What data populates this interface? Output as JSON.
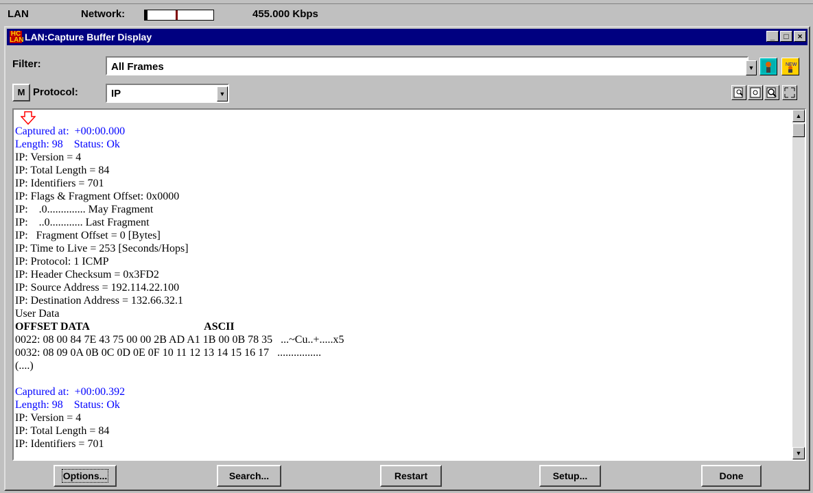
{
  "statusbar": {
    "label": "LAN",
    "network_label": "Network:",
    "network_utilization": 0.42,
    "network_peak": 0.45,
    "rate": "455.000 Kbps"
  },
  "window": {
    "title": "LAN:Capture Buffer Display",
    "minimize_glyph": "_",
    "maximize_glyph": "□",
    "close_glyph": "×"
  },
  "filter": {
    "label": "Filter:",
    "value": "All Frames"
  },
  "protocol": {
    "m_label": "M",
    "label": "Protocol:",
    "value": "IP"
  },
  "display": {
    "lines": [
      {
        "text": "Captured at:  +00:00.000",
        "style": "blue"
      },
      {
        "text": "Length: 98    Status: Ok",
        "style": "blue"
      },
      {
        "text": "IP: Version = 4",
        "style": ""
      },
      {
        "text": "IP: Total Length = 84",
        "style": ""
      },
      {
        "text": "IP: Identifiers = 701",
        "style": ""
      },
      {
        "text": "IP: Flags & Fragment Offset: 0x0000",
        "style": ""
      },
      {
        "text": "IP:    .0.............. May Fragment",
        "style": ""
      },
      {
        "text": "IP:    ..0............ Last Fragment",
        "style": ""
      },
      {
        "text": "IP:   Fragment Offset = 0 [Bytes]",
        "style": ""
      },
      {
        "text": "IP: Time to Live = 253 [Seconds/Hops]",
        "style": ""
      },
      {
        "text": "IP: Protocol: 1 ICMP",
        "style": ""
      },
      {
        "text": "IP: Header Checksum = 0x3FD2",
        "style": ""
      },
      {
        "text": "IP: Source Address = 192.114.22.100",
        "style": ""
      },
      {
        "text": "IP: Destination Address = 132.66.32.1",
        "style": ""
      },
      {
        "text": "User Data",
        "style": ""
      },
      {
        "text": "OFFSET DATA                                          ASCII",
        "style": "bold"
      },
      {
        "text": "0022: 08 00 84 7E 43 75 00 00 2B AD A1 1B 00 0B 78 35   ...~Cu..+.....x5",
        "style": ""
      },
      {
        "text": "0032: 08 09 0A 0B 0C 0D 0E 0F 10 11 12 13 14 15 16 17   ................",
        "style": ""
      },
      {
        "text": "(....)",
        "style": ""
      },
      {
        "text": "",
        "style": ""
      },
      {
        "text": "Captured at:  +00:00.392",
        "style": "blue"
      },
      {
        "text": "Length: 98    Status: Ok",
        "style": "blue"
      },
      {
        "text": "IP: Version = 4",
        "style": ""
      },
      {
        "text": "IP: Total Length = 84",
        "style": ""
      },
      {
        "text": "IP: Identifiers = 701",
        "style": ""
      }
    ]
  },
  "buttons": {
    "options": "Options...",
    "search": "Search...",
    "restart": "Restart",
    "setup": "Setup...",
    "done": "Done"
  },
  "colors": {
    "title_bar": "#000080",
    "header_text": "#0000ff",
    "arrow": "#ff0000"
  }
}
